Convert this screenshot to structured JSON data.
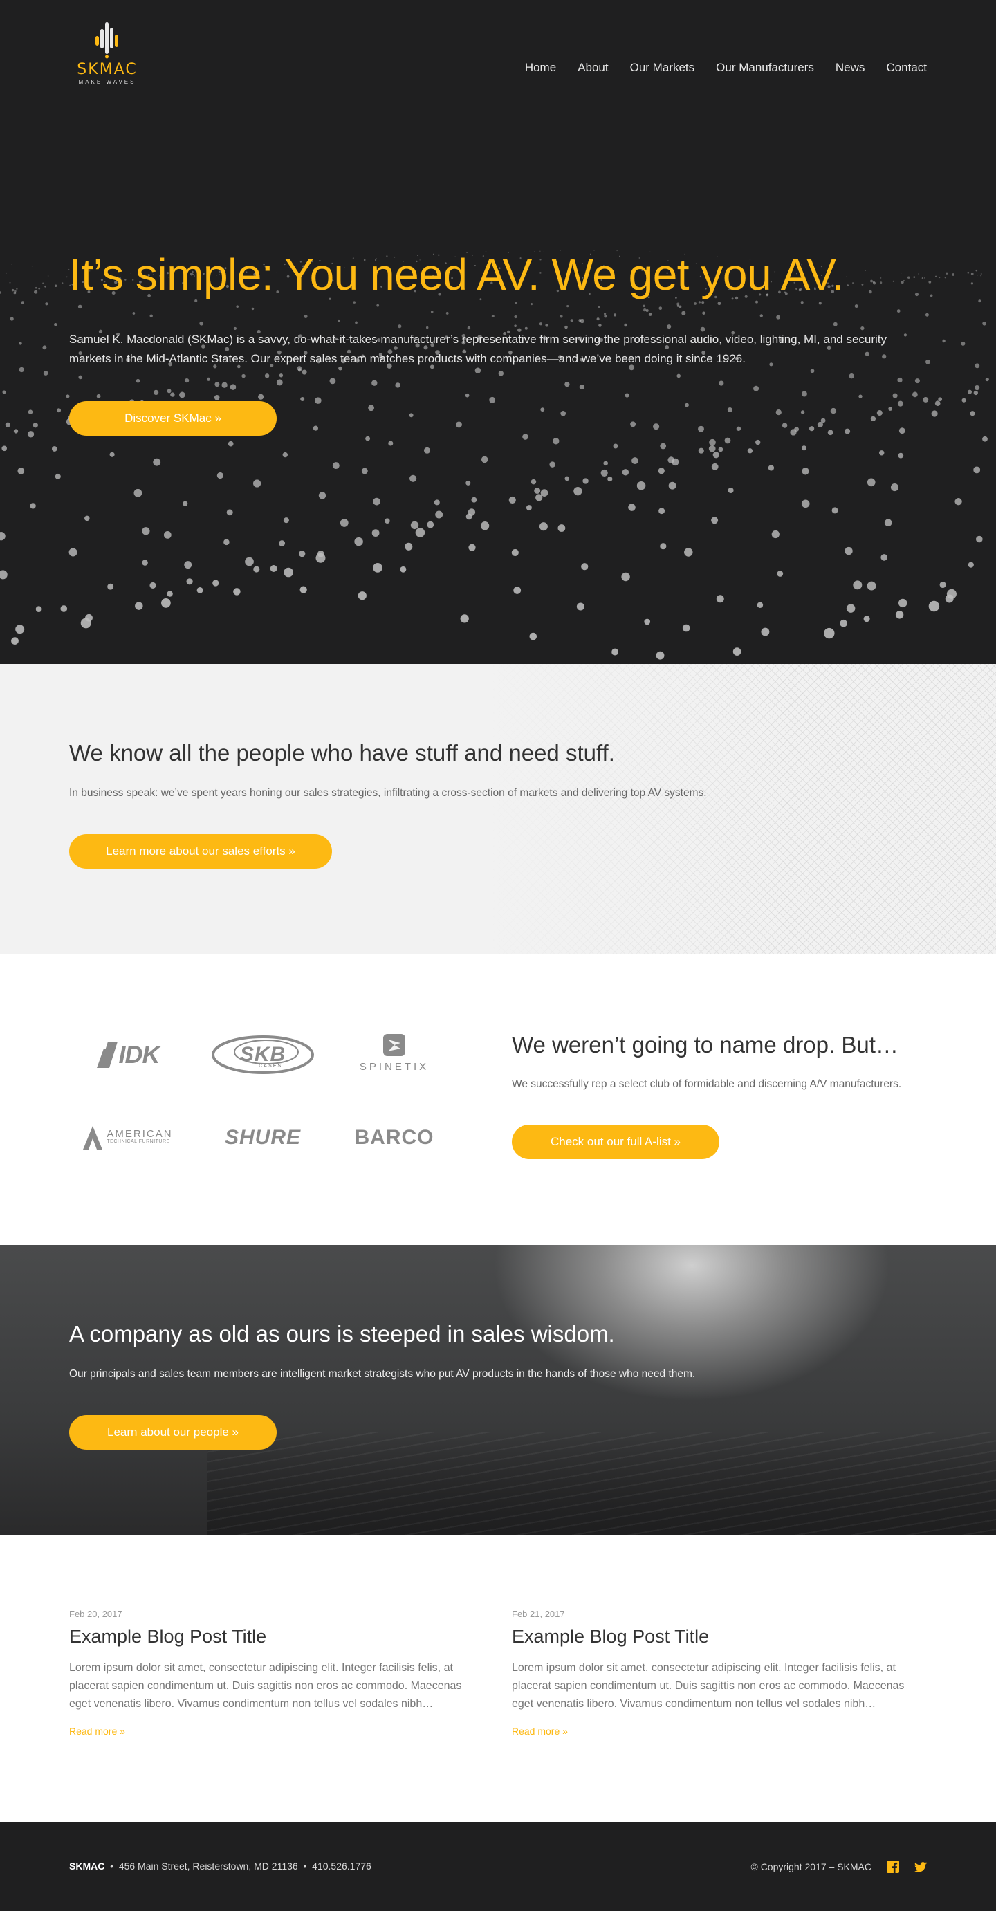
{
  "header": {
    "logo_text_sk": "SK",
    "logo_text_mac": "MAC",
    "logo_tagline": "MAKE WAVES",
    "nav": [
      {
        "label": "Home"
      },
      {
        "label": "About"
      },
      {
        "label": "Our Markets"
      },
      {
        "label": "Our Manufacturers"
      },
      {
        "label": "News"
      },
      {
        "label": "Contact"
      }
    ]
  },
  "hero": {
    "title": "It’s simple: You need AV. We get you AV.",
    "text": "Samuel K. Macdonald (SKMac) is a savvy, do-what-it-takes manufacturer’s representative firm serving the professional audio, video, lighting, MI, and security markets in the Mid-Atlantic States. Our expert sales team matches products with companies—and we’ve been doing it since 1926.",
    "button": "Discover SKMac »"
  },
  "sales": {
    "title": "We know all the people who have stuff and need stuff.",
    "text": "In business speak: we’ve spent years honing our sales strategies, infiltrating a cross-section of markets and delivering top AV systems.",
    "button": "Learn more about our sales efforts »"
  },
  "brands": {
    "logos": [
      {
        "name": "IDK"
      },
      {
        "name": "SKB"
      },
      {
        "name": "SPINETIX"
      },
      {
        "name": "AMERICAN",
        "sub": "TECHNICAL FURNITURE"
      },
      {
        "name": "SHURE"
      },
      {
        "name": "BARCO"
      }
    ],
    "skb_sub": "CASES",
    "title": "We weren’t going to name drop. But…",
    "text": "We successfully rep a select club of formidable and discerning A/V manufacturers.",
    "button": "Check out our full A-list »"
  },
  "people": {
    "title": "A company as old as ours is steeped in sales wisdom.",
    "text": "Our principals and sales team members are intelligent market strategists who put AV products in the hands of those who need them.",
    "button": "Learn about our people »"
  },
  "blog": {
    "posts": [
      {
        "date": "Feb 20, 2017",
        "title": "Example Blog Post Title",
        "excerpt": "Lorem ipsum dolor sit amet, consectetur adipiscing elit. Integer facilisis felis, at placerat sapien condimentum ut. Duis sagittis non eros ac commodo. Maecenas eget venenatis libero. Vivamus condimentum non tellus vel sodales nibh…",
        "more": "Read more »"
      },
      {
        "date": "Feb 21, 2017",
        "title": "Example Blog Post Title",
        "excerpt": "Lorem ipsum dolor sit amet, consectetur adipiscing elit. Integer facilisis felis, at placerat sapien condimentum ut. Duis sagittis non eros ac commodo. Maecenas eget venenatis libero. Vivamus condimentum non tellus vel sodales nibh…",
        "more": "Read more »"
      }
    ]
  },
  "footer": {
    "brand": "SKMAC",
    "sep": "•",
    "address": "456 Main Street, Reisterstown, MD 21136",
    "phone": "410.526.1776",
    "copyright": "© Copyright 2017 – SKMAC",
    "social": [
      {
        "icon": "facebook-icon"
      },
      {
        "icon": "twitter-icon"
      }
    ]
  },
  "colors": {
    "accent": "#fdb913",
    "dark": "#1f1f20",
    "light_section": "#f2f2f2"
  }
}
